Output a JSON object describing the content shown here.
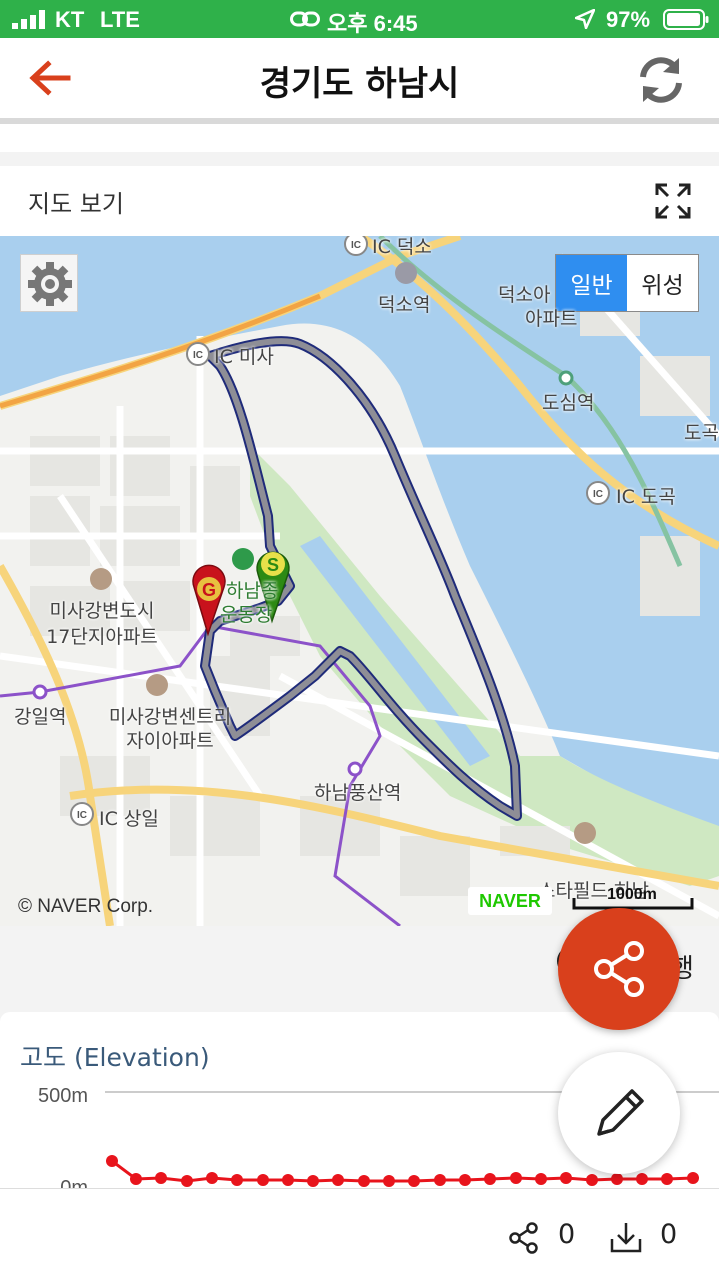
{
  "status_bar": {
    "carrier": "KT",
    "network": "LTE",
    "time": "오후 6:45",
    "battery": "97%",
    "battery_level": 0.97
  },
  "header": {
    "title": "경기도 하남시",
    "back_icon": "back-arrow-icon",
    "refresh_icon": "refresh-icon"
  },
  "map_section": {
    "title": "지도 보기",
    "toggle": {
      "normal": "일반",
      "satellite": "위성",
      "selected": "normal"
    },
    "labels": {
      "ic_deokso": "IC 덕소",
      "deokso_station": "덕소역",
      "deokso_apt_1": "덕소아",
      "deokso_apt_2": "아파트",
      "ic_misa": "IC 미사",
      "dosim_station": "도심역",
      "doc": "도곡",
      "ic_dogok": "IC 도곡",
      "misa_apt_1": "미사강변도시",
      "misa_apt_2": "17단지아파트",
      "hanam_stadium_1": "하남종",
      "hanam_stadium_2": "운동장",
      "gangil_station": "강일역",
      "misa_centre_1": "미사강변센트리",
      "misa_centre_2": "자이아파트",
      "pungsan_station": "하남풍산역",
      "ic_sangil": "IC 상일",
      "starfield": "스타필드 하남"
    },
    "copyright": "© NAVER Corp.",
    "brand": "NAVER",
    "scale": "1000m",
    "markers": {
      "start": "S",
      "goal": "G"
    }
  },
  "elevation": {
    "title": "고도 (Elevation)",
    "y_ticks": [
      "500m",
      "0m"
    ]
  },
  "behind_fab_text": "행",
  "bottom_bar": {
    "share_count": "0",
    "download_count": "0"
  }
}
